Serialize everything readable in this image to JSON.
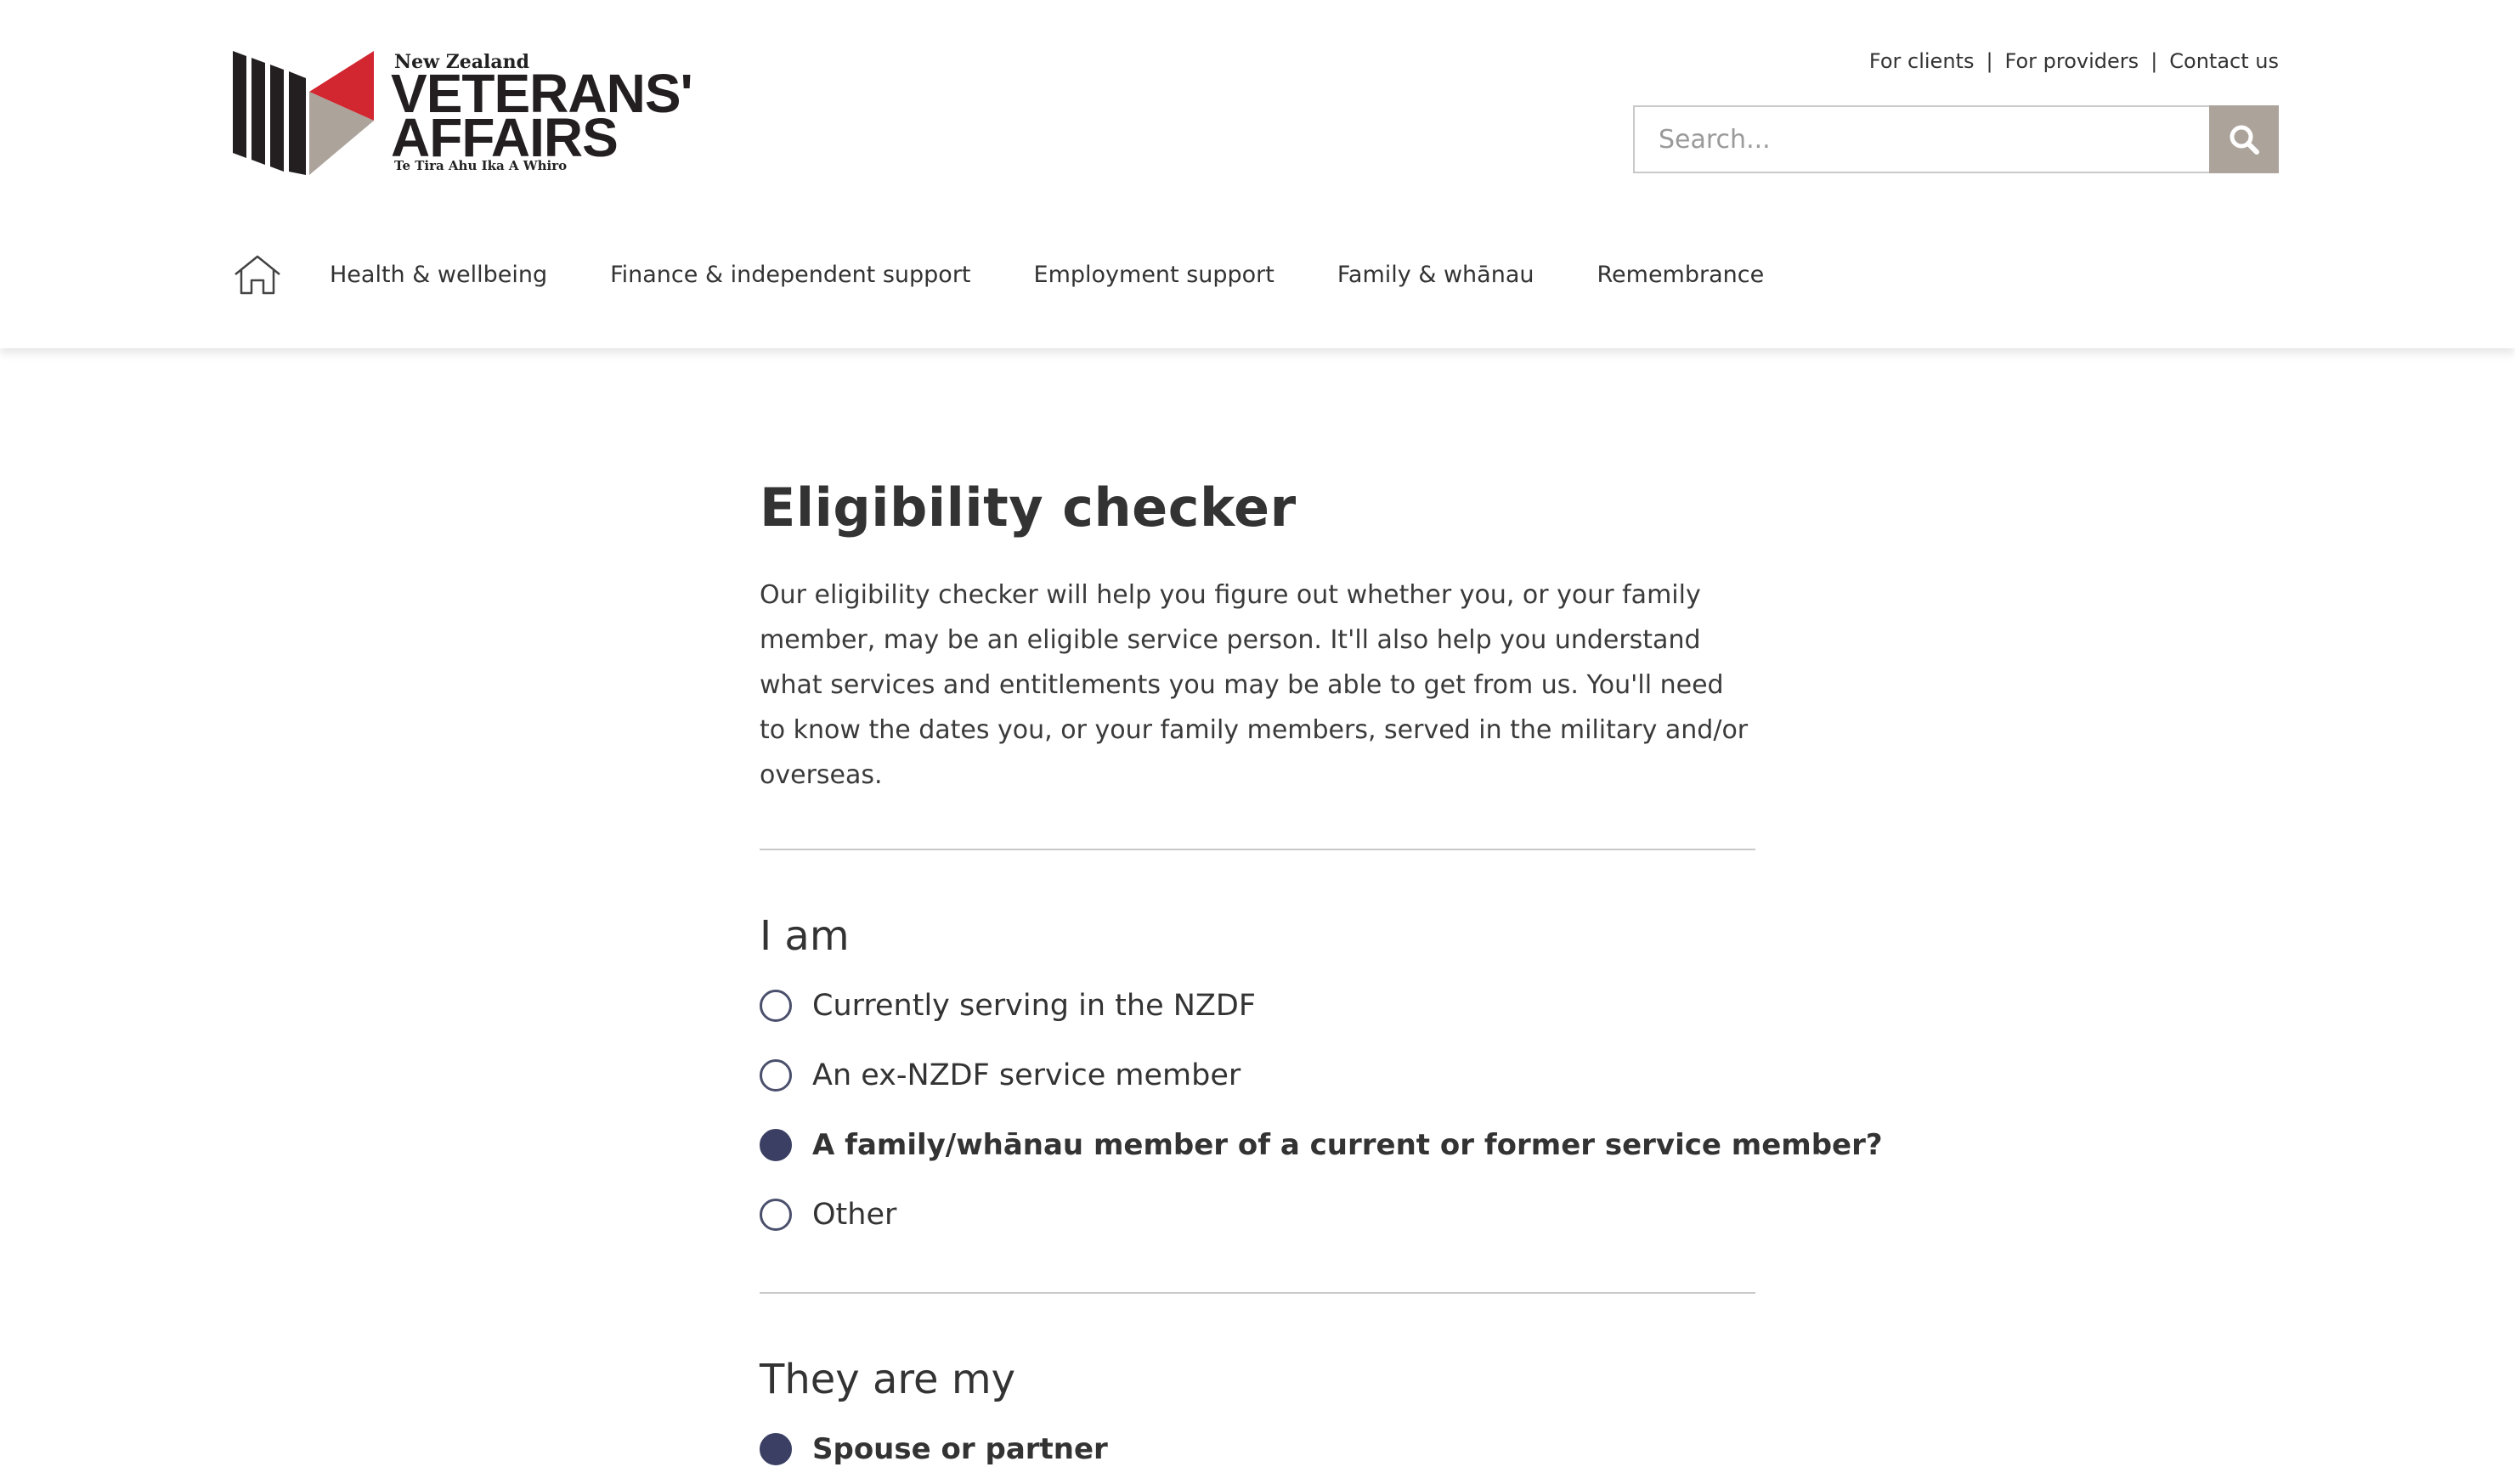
{
  "logo": {
    "country": "New Zealand",
    "line1": "VETERANS'",
    "line2": "AFFAIRS",
    "tagline": "Te Tira Ahu Ika A Whiro",
    "colors": {
      "red": "#d22630",
      "grey": "#aca39b",
      "dark": "#231f20"
    }
  },
  "utility_links": [
    {
      "label": "For clients"
    },
    {
      "label": "For providers"
    },
    {
      "label": "Contact us"
    }
  ],
  "utility_separator": "|",
  "search": {
    "placeholder": "Search...",
    "value": "",
    "button_icon": "search-icon"
  },
  "nav": {
    "home_icon": "home-icon",
    "items": [
      {
        "label": "Health & wellbeing"
      },
      {
        "label": "Finance & independent support"
      },
      {
        "label": "Employment support"
      },
      {
        "label": "Family & whānau"
      },
      {
        "label": "Remembrance"
      }
    ]
  },
  "main": {
    "title": "Eligibility checker",
    "intro": "Our eligibility checker will help you figure out whether you, or your family member, may be an eligible service person. It'll also help you understand what services and entitlements you may be able to get from us. You'll need to know the dates you, or your family members, served in the military and/or overseas.",
    "questions": [
      {
        "title": "I am",
        "options": [
          {
            "label": "Currently serving in the NZDF",
            "selected": false
          },
          {
            "label": "An ex-NZDF service member",
            "selected": false
          },
          {
            "label": "A family/whānau member of a current or former service member?",
            "selected": true
          },
          {
            "label": "Other",
            "selected": false
          }
        ]
      },
      {
        "title": "They are my",
        "options": [
          {
            "label": "Spouse or partner",
            "selected": true
          }
        ]
      }
    ]
  },
  "colors": {
    "radio_selected": "#3a3f63",
    "search_button": "#aca39b",
    "text": "#333333",
    "divider": "#c9c9c9"
  }
}
